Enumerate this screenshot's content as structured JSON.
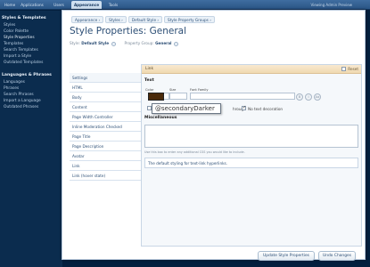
{
  "nav": {
    "tabs": [
      "Home",
      "Applications",
      "Users",
      "Appearance",
      "Tools"
    ],
    "active_tab": "Appearance",
    "right_text": "Viewing Admin Preview"
  },
  "sidebar": {
    "groups": [
      {
        "title": "Styles & Templates",
        "items": [
          "Styles",
          "Color Palette",
          "Style Properties",
          "Templates",
          "Search Templates",
          "Import a Style",
          "Outdated Templates"
        ]
      },
      {
        "title": "Languages & Phrases",
        "items": [
          "Languages",
          "Phrases",
          "Search Phrases",
          "Import a Language",
          "Outdated Phrases"
        ]
      }
    ]
  },
  "breadcrumbs": [
    "Appearance ›",
    "Styles ›",
    "Default Style ›",
    "Style Property Groups ›"
  ],
  "page_title": "Style Properties: General",
  "filters": {
    "style_label": "Style:",
    "style_value": "Default Style",
    "group_label": "Property Group:",
    "group_value": "General"
  },
  "properties": [
    "Settings",
    "HTML",
    "Body",
    "Content",
    "Page Width Controller",
    "Inline Moderation Checked",
    "Page Title",
    "Page Description",
    "Avatar",
    "Link",
    "Link (hover state)"
  ],
  "active_property": "Link",
  "editor": {
    "title": "Link",
    "reset_label": "Reset",
    "text_label": "Text",
    "color_label": "Color",
    "size_label": "Size",
    "font_family_label": "Font Family",
    "round_buttons": [
      "B",
      "I",
      "Aa"
    ],
    "through_label": "hrough",
    "no_decoration_label": "No text decoration",
    "tooltip": "@secondaryDarker",
    "misc_label": "Miscellaneous",
    "hint": "Use this box to enter any additional CSS you would like to include.",
    "description": "The default styling for text-link hyperlinks."
  },
  "buttons": {
    "update": "Update Style Properties",
    "undo": "Undo Changes"
  },
  "colors": {
    "nav_bg": "#2a5585",
    "sidebar_bg": "#0b2c4e",
    "title": "#2c4e75",
    "editor_head": "#f0d9b0",
    "swatch": "#4a2a0a"
  }
}
